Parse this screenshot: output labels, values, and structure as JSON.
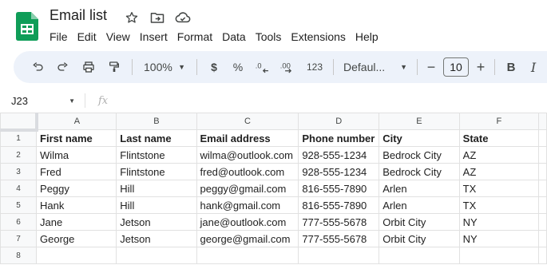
{
  "app": {
    "title": "Email list",
    "menu": [
      "File",
      "Edit",
      "View",
      "Insert",
      "Format",
      "Data",
      "Tools",
      "Extensions",
      "Help"
    ]
  },
  "toolbar": {
    "zoom": "100%",
    "currency": "$",
    "percent": "%",
    "format_123": "123",
    "font": "Defaul...",
    "font_size": "10",
    "bold": "B",
    "italic": "I"
  },
  "formula_bar": {
    "cell_ref": "J23",
    "fx": "fx"
  },
  "sheet": {
    "columns": [
      "A",
      "B",
      "C",
      "D",
      "E",
      "F"
    ],
    "rows": [
      {
        "num": "1",
        "cells": [
          "First name",
          "Last name",
          "Email address",
          "Phone number",
          "City",
          "State"
        ]
      },
      {
        "num": "2",
        "cells": [
          "Wilma",
          "Flintstone",
          "wilma@outlook.com",
          "928-555-1234",
          "Bedrock City",
          "AZ"
        ]
      },
      {
        "num": "3",
        "cells": [
          "Fred",
          "Flintstone",
          "fred@outlook.com",
          "928-555-1234",
          "Bedrock City",
          "AZ"
        ]
      },
      {
        "num": "4",
        "cells": [
          "Peggy",
          "Hill",
          "peggy@gmail.com",
          "816-555-7890",
          "Arlen",
          "TX"
        ]
      },
      {
        "num": "5",
        "cells": [
          "Hank",
          "Hill",
          "hank@gmail.com",
          "816-555-7890",
          "Arlen",
          "TX"
        ]
      },
      {
        "num": "6",
        "cells": [
          "Jane",
          "Jetson",
          "jane@outlook.com",
          "777-555-5678",
          "Orbit City",
          "NY"
        ]
      },
      {
        "num": "7",
        "cells": [
          "George",
          "Jetson",
          "george@gmail.com",
          "777-555-5678",
          "Orbit City",
          "NY"
        ]
      },
      {
        "num": "8",
        "cells": [
          "",
          "",
          "",
          "",
          "",
          ""
        ]
      }
    ]
  },
  "colors": {
    "accent_green": "#0f9d58",
    "toolbar_bg": "#edf2fa"
  }
}
